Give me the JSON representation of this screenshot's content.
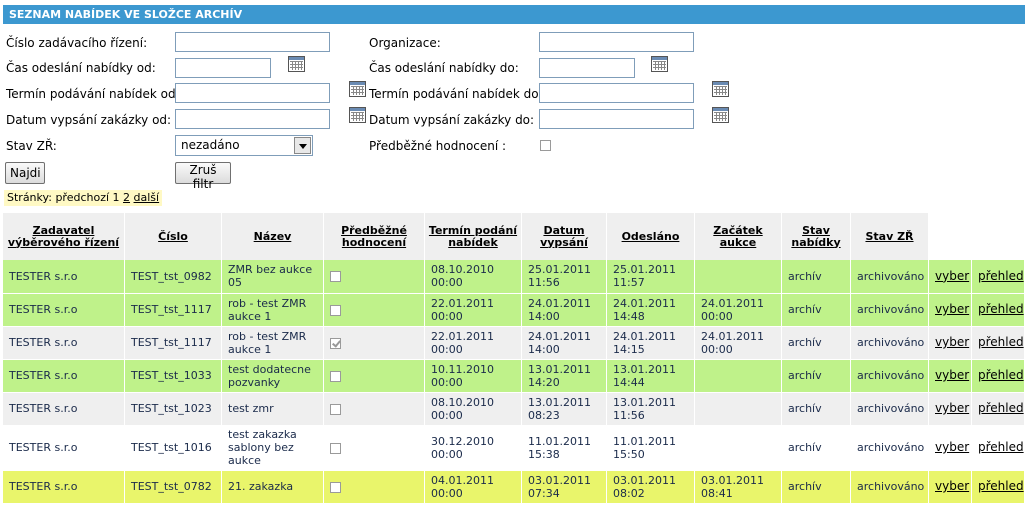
{
  "title": "SEZNAM NABÍDEK VE SLOŽCE ARCHÍV",
  "filters": {
    "cislo_label": "Číslo zadávacího řízení:",
    "cislo_value": "",
    "organizace_label": "Organizace:",
    "organizace_value": "",
    "cas_od_label": "Čas odeslání nabídky od:",
    "cas_od_value": "",
    "cas_do_label": "Čas odeslání nabídky do:",
    "cas_do_value": "",
    "termin_od_label": "Termín podávání nabídek od:",
    "termin_od_value": "",
    "termin_do_label": "Termín podávání nabídek do:",
    "termin_do_value": "",
    "datum_od_label": "Datum vypsání zakázky od:",
    "datum_od_value": "",
    "datum_do_label": "Datum vypsání zakázky do:",
    "datum_do_value": "",
    "stav_label": "Stav ZŘ:",
    "stav_value": "nezadáno",
    "predbezne_label": "Předběžné hodnocení :",
    "predbezne_checked": false
  },
  "buttons": {
    "najdi": "Najdi",
    "zrus": "Zruš filtr"
  },
  "pager": {
    "label": "Stránky:",
    "prev": "předchozí",
    "page1": "1",
    "page2": "2",
    "next": "další"
  },
  "table": {
    "headers": {
      "zadavatel": "Zadavatel výběrového řízení",
      "cislo": "Číslo",
      "nazev": "Název",
      "predbezne": "Předběžné hodnocení",
      "termin": "Termín podání nabídek",
      "datum": "Datum vypsání",
      "odeslano": "Odesláno",
      "zacatek": "Začátek aukce",
      "stav_nabidky": "Stav nabídky",
      "stav_zr": "Stav ZŘ"
    },
    "rows": [
      {
        "zadavatel": "TESTER s.r.o",
        "cislo": "TEST_tst_0982",
        "nazev": "ZMR bez aukce 05",
        "checked": false,
        "termin": "08.10.2010 00:00",
        "datum": "25.01.2011 11:56",
        "odeslano": "25.01.2011 11:57",
        "zacatek": "",
        "stav_nabidky": "archív",
        "stav_zr": "archivováno",
        "vyber": "vyber",
        "prehled": "přehled"
      },
      {
        "zadavatel": "TESTER s.r.o",
        "cislo": "TEST_tst_1117",
        "nazev": "rob - test ZMR aukce 1",
        "checked": false,
        "termin": "22.01.2011 00:00",
        "datum": "24.01.2011 14:00",
        "odeslano": "24.01.2011 14:48",
        "zacatek": "24.01.2011 00:00",
        "stav_nabidky": "archív",
        "stav_zr": "archivováno",
        "vyber": "vyber",
        "prehled": "přehled"
      },
      {
        "zadavatel": "TESTER s.r.o",
        "cislo": "TEST_tst_1117",
        "nazev": "rob - test ZMR aukce 1",
        "checked": true,
        "termin": "22.01.2011 00:00",
        "datum": "24.01.2011 14:00",
        "odeslano": "24.01.2011 14:15",
        "zacatek": "24.01.2011 00:00",
        "stav_nabidky": "archív",
        "stav_zr": "archivováno",
        "vyber": "vyber",
        "prehled": "přehled"
      },
      {
        "zadavatel": "TESTER s.r.o",
        "cislo": "TEST_tst_1033",
        "nazev": "test dodatecne pozvanky",
        "checked": false,
        "termin": "10.11.2010 00:00",
        "datum": "13.01.2011 14:20",
        "odeslano": "13.01.2011 14:44",
        "zacatek": "",
        "stav_nabidky": "archív",
        "stav_zr": "archivováno",
        "vyber": "vyber",
        "prehled": "přehled"
      },
      {
        "zadavatel": "TESTER s.r.o",
        "cislo": "TEST_tst_1023",
        "nazev": "test zmr",
        "checked": false,
        "termin": "08.10.2010 00:00",
        "datum": "13.01.2011 08:23",
        "odeslano": "13.01.2011 11:56",
        "zacatek": "",
        "stav_nabidky": "archív",
        "stav_zr": "archivováno",
        "vyber": "vyber",
        "prehled": "přehled"
      },
      {
        "zadavatel": "TESTER s.r.o",
        "cislo": "TEST_tst_1016",
        "nazev": "test zakazka sablony bez aukce",
        "checked": false,
        "termin": "30.12.2010 00:00",
        "datum": "11.01.2011 15:38",
        "odeslano": "11.01.2011 15:50",
        "zacatek": "",
        "stav_nabidky": "archív",
        "stav_zr": "archivováno",
        "vyber": "vyber",
        "prehled": "přehled"
      },
      {
        "zadavatel": "TESTER s.r.o",
        "cislo": "TEST_tst_0782",
        "nazev": "21. zakazka",
        "checked": false,
        "termin": "04.01.2011 00:00",
        "datum": "03.01.2011 07:34",
        "odeslano": "03.01.2011 08:02",
        "zacatek": "03.01.2011 08:41",
        "stav_nabidky": "archív",
        "stav_zr": "archivováno",
        "vyber": "vyber",
        "prehled": "přehled"
      }
    ]
  },
  "colors": {
    "header": "#3c98d0",
    "row_green": "#bff28a",
    "row_gray": "#efefef",
    "row_yellow": "#e9f56b"
  }
}
